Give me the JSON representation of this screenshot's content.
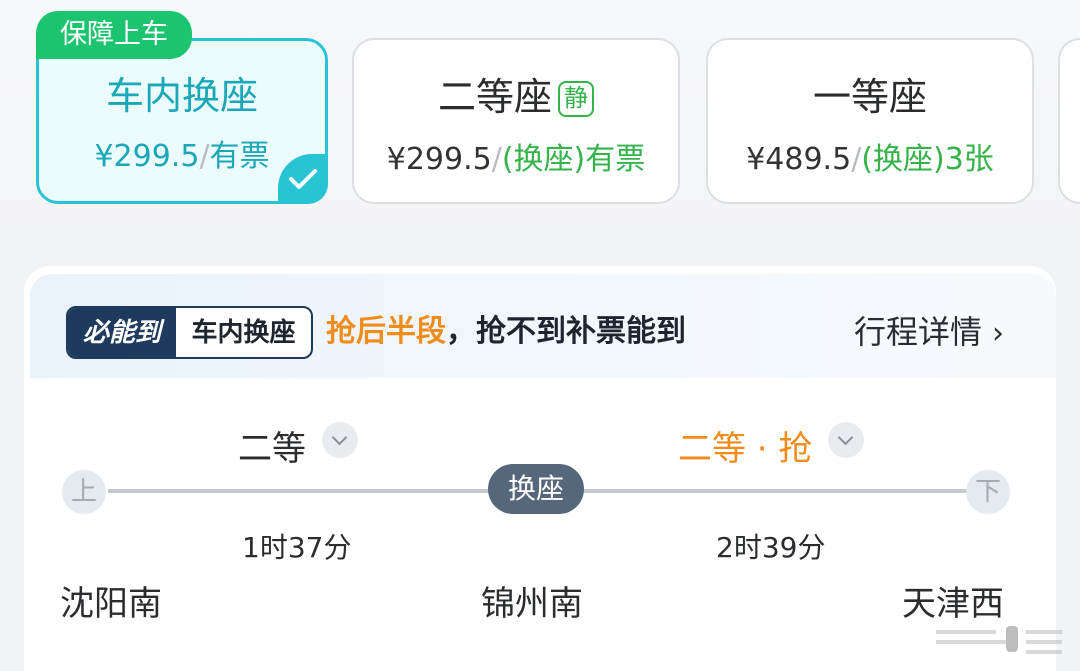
{
  "seat_options": [
    {
      "tag": "保障上车",
      "name": "车内换座",
      "price": "¥299.5",
      "separator": "/",
      "availability": "有票",
      "selected": true
    },
    {
      "name": "二等座",
      "quiet_badge": "静",
      "price": "¥299.5",
      "separator": "/",
      "availability": "(换座)有票",
      "selected": false
    },
    {
      "name": "一等座",
      "price": "¥489.5",
      "separator": "/",
      "availability": "(换座)3张",
      "selected": false
    }
  ],
  "journey": {
    "tag_dark": "必能到",
    "tag_light": "车内换座",
    "message_highlight": "抢后半段",
    "message_rest": "，抢不到补票能到",
    "detail_link": "行程详情",
    "detail_chevron": "›",
    "segments": [
      {
        "seat_class": "二等"
      },
      {
        "seat_class": "二等 · 抢"
      }
    ],
    "board_node": "上",
    "alight_node": "下",
    "transfer_label": "换座",
    "durations": [
      "1时37分",
      "2时39分"
    ],
    "stations": [
      "沈阳南",
      "锦州南",
      "天津西"
    ]
  },
  "colors": {
    "accent_teal": "#28c4d6",
    "tag_green": "#1dc46f",
    "available_green": "#35b34a",
    "grab_orange": "#f08c1a",
    "navy": "#1e3a5c"
  },
  "icons": {
    "selected_check": "check-icon",
    "segment_dropdown": "chevron-down-icon",
    "detail": "chevron-right-icon"
  }
}
